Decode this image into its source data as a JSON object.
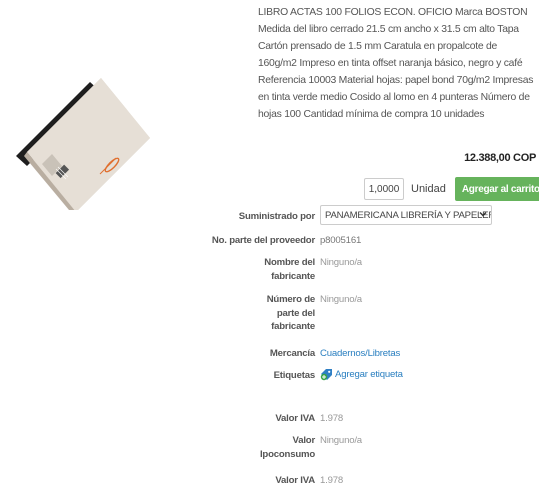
{
  "product": {
    "description": "LIBRO ACTAS 100 FOLIOS ECON. OFICIO Marca BOSTON Medida del libro cerrado 21.5 cm ancho x 31.5 cm alto Tapa Cartón prensado de 1.5 mm Caratula en propalcote de 160g/m2 Impreso en tinta offset naranja básico, negro y café Referencia 10003 Material hojas: papel bond 70g/m2 Impresas en tinta verde medio Cosido al lomo en 4 punteras Número de hojas 100 Cantidad mínima de compra 10 unidades",
    "price": "12.388,00 COP"
  },
  "purchase": {
    "quantity": "1,0000",
    "unit_label": "Unidad",
    "add_to_cart_label": "Agregar al carrito"
  },
  "details": {
    "supplier_label": "Suministrado por",
    "supplier_value": "PANAMERICANA LIBRERÍA Y PAPELERÍA",
    "supplier_part_label": "No. parte del proveedor",
    "supplier_part_value": "p8005161",
    "manufacturer_name_label": "Nombre del fabricante",
    "manufacturer_name_value": "Ninguno/a",
    "manufacturer_part_label": "Número de parte del fabricante",
    "manufacturer_part_value": "Ninguno/a",
    "merchandise_label": "Mercancía",
    "merchandise_value": "Cuadernos/Libretas",
    "tags_label": "Etiquetas",
    "tags_add_label": "Agregar etiqueta",
    "iva_label_1": "Valor IVA",
    "iva_value_1": "1.978",
    "ipoconsumo_label": "Valor Ipoconsumo",
    "ipoconsumo_value": "Ninguno/a",
    "iva_label_2": "Valor IVA",
    "iva_value_2": "1.978"
  },
  "colors": {
    "accent_green": "#66b35c",
    "link_blue": "#2a7fc0"
  }
}
